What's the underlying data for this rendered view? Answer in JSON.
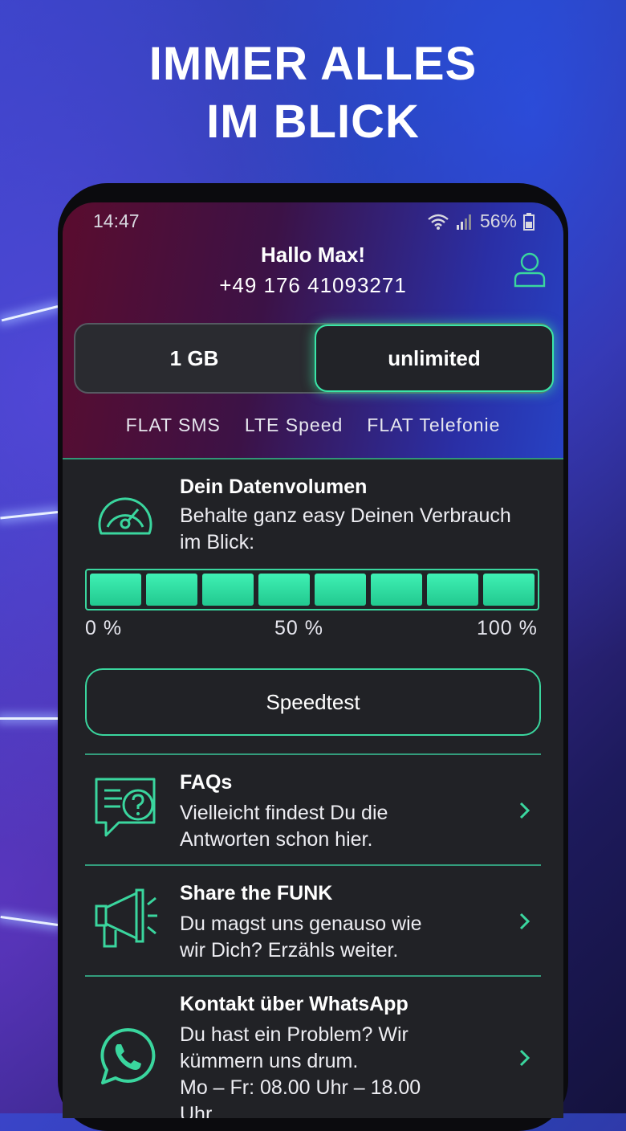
{
  "headline": {
    "line1": "IMMER ALLES",
    "line2": "IM BLICK"
  },
  "status_bar": {
    "time": "14:47",
    "battery": "56%"
  },
  "header": {
    "greeting": "Hallo Max!",
    "phone_number": "+49 176 41093271",
    "plans": [
      {
        "label": "1 GB",
        "selected": false
      },
      {
        "label": "unlimited",
        "selected": true
      }
    ],
    "features": [
      "FLAT SMS",
      "LTE Speed",
      "FLAT Telefonie"
    ]
  },
  "data_volume": {
    "title": "Dein Datenvolumen",
    "text_line1": "Behalte ganz easy Deinen Verbrauch",
    "text_line2": "im Blick:",
    "usage_fraction": 1.0,
    "segments": 8,
    "scale": [
      "0 %",
      "50 %",
      "100 %"
    ]
  },
  "speedtest_label": "Speedtest",
  "menu": [
    {
      "title": "FAQs",
      "lines": [
        "Vielleicht findest Du die",
        "Antworten schon hier."
      ]
    },
    {
      "title": "Share the FUNK",
      "lines": [
        "Du magst uns genauso wie",
        "wir Dich? Erzähls weiter."
      ]
    },
    {
      "title": "Kontakt über WhatsApp",
      "lines": [
        "Du hast ein Problem? Wir",
        "kümmern uns drum.",
        "Mo – Fr: 08.00 Uhr – 18.00",
        "Uhr"
      ]
    }
  ],
  "colors": {
    "accent": "#3ad69e",
    "screen_bg": "#212226"
  }
}
